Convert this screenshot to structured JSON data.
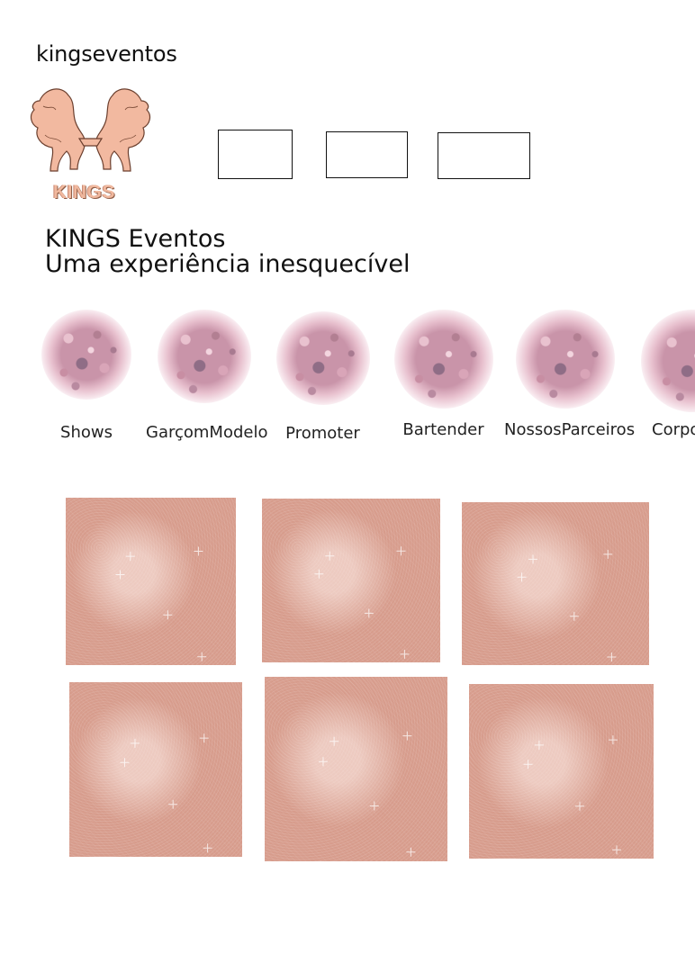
{
  "header": {
    "username": "kingseventos"
  },
  "logo": {
    "word": "KINGS",
    "icon": "twin-lions-logo"
  },
  "highlight_boxes": [
    {
      "label": ""
    },
    {
      "label": ""
    },
    {
      "label": ""
    }
  ],
  "hero": {
    "title": "KINGS Eventos",
    "subtitle": "Uma experiência inesquecível"
  },
  "categories": [
    {
      "label": "Shows"
    },
    {
      "label": "GarçomModelo"
    },
    {
      "label": "Promoter"
    },
    {
      "label": "Bartender"
    },
    {
      "label": "NossosParceiros"
    },
    {
      "label": "Corporativo"
    }
  ],
  "grid": {
    "tile_count": 6
  },
  "colors": {
    "accent": "#d79c8c",
    "logo": "#f0b89e"
  }
}
